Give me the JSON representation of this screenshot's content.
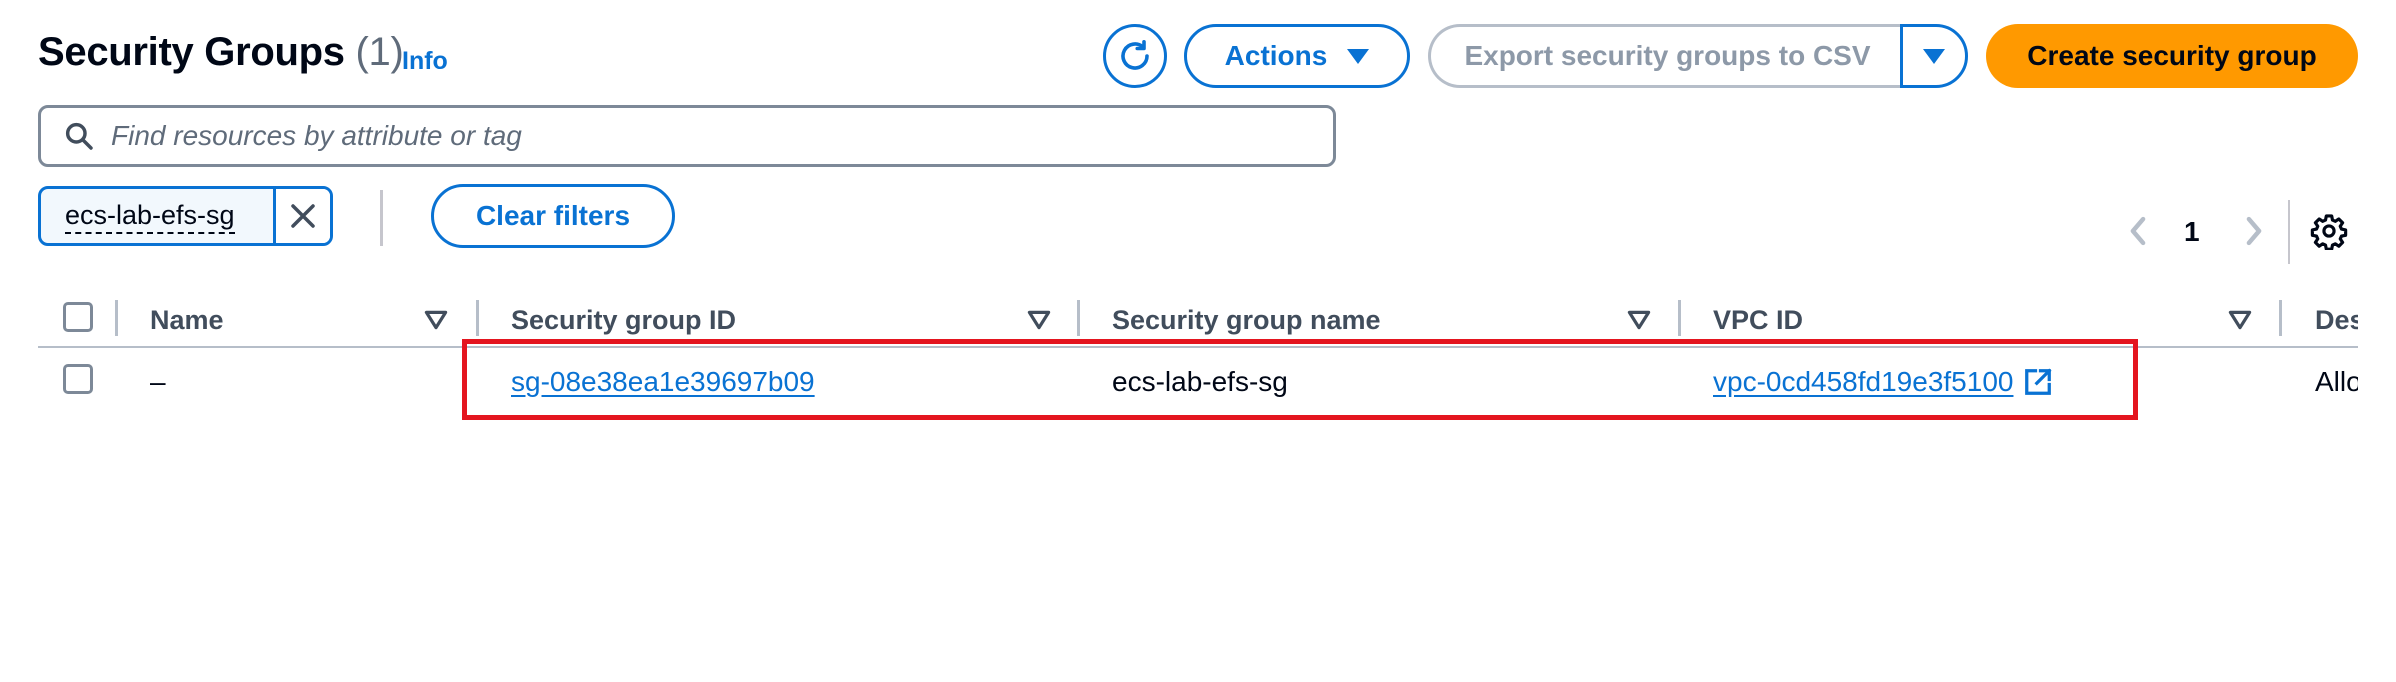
{
  "header": {
    "title": "Security Groups",
    "count": "(1)",
    "info_label": "Info",
    "actions_label": "Actions",
    "export_label": "Export security groups to CSV",
    "create_label": "Create security group"
  },
  "search": {
    "placeholder": "Find resources by attribute or tag",
    "value": ""
  },
  "filters": {
    "token_label": "ecs-lab-efs-sg",
    "clear_label": "Clear filters"
  },
  "pagination": {
    "current_page": "1"
  },
  "table": {
    "columns": [
      "Name",
      "Security group ID",
      "Security group name",
      "VPC ID",
      "Des"
    ],
    "rows": [
      {
        "name": "–",
        "security_group_id": "sg-08e38ea1e39697b09",
        "security_group_name": "ecs-lab-efs-sg",
        "vpc_id": "vpc-0cd458fd19e3f5100",
        "description": "Allo"
      }
    ]
  },
  "colors": {
    "accent": "#0972d3",
    "primary_button": "#ff9900",
    "highlight_border": "#e4151f",
    "text": "#000716"
  },
  "icons": [
    "refresh-icon",
    "caret-down-icon",
    "search-icon",
    "close-icon",
    "chevron-left-icon",
    "chevron-right-icon",
    "settings-icon",
    "sort-icon",
    "external-link-icon"
  ]
}
